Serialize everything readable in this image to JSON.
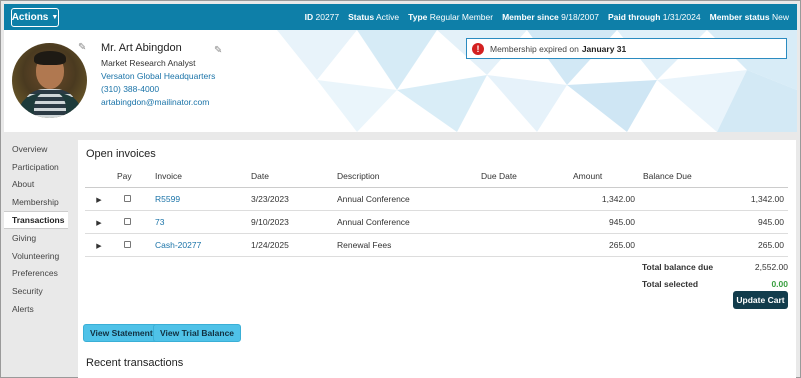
{
  "topbar": {
    "actions_label": "Actions",
    "meta": [
      {
        "label": "ID",
        "value": "20277"
      },
      {
        "label": "Status",
        "value": "Active"
      },
      {
        "label": "Type",
        "value": "Regular Member"
      },
      {
        "label": "Member since",
        "value": "9/18/2007"
      },
      {
        "label": "Paid through",
        "value": "1/31/2024"
      },
      {
        "label": "Member status",
        "value": "New"
      }
    ]
  },
  "profile": {
    "name": "Mr. Art Abingdon",
    "title": "Market Research Analyst",
    "company": "Versaton Global Headquarters",
    "phone": "(310) 388-4000",
    "email": "artabingdon@mailinator.com"
  },
  "alert": {
    "text": "Membership expired on",
    "date": "January 31"
  },
  "sidebar": {
    "items": [
      {
        "label": "Overview"
      },
      {
        "label": "Participation"
      },
      {
        "label": "About"
      },
      {
        "label": "Membership"
      },
      {
        "label": "Transactions",
        "active": true
      },
      {
        "label": "Giving"
      },
      {
        "label": "Volunteering"
      },
      {
        "label": "Preferences"
      },
      {
        "label": "Security"
      },
      {
        "label": "Alerts"
      }
    ]
  },
  "invoices": {
    "title": "Open invoices",
    "columns": [
      "",
      "Pay",
      "Invoice",
      "Date",
      "Description",
      "Due Date",
      "Amount",
      "Balance Due"
    ],
    "rows": [
      {
        "invoice": "R5599",
        "date": "3/23/2023",
        "description": "Annual Conference",
        "due_date": "",
        "amount": "1,342.00",
        "balance": "1,342.00"
      },
      {
        "invoice": "73",
        "date": "9/10/2023",
        "description": "Annual Conference",
        "due_date": "",
        "amount": "945.00",
        "balance": "945.00"
      },
      {
        "invoice": "Cash-20277",
        "date": "1/24/2025",
        "description": "Renewal Fees",
        "due_date": "",
        "amount": "265.00",
        "balance": "265.00"
      }
    ],
    "total_balance_label": "Total balance due",
    "total_balance_value": "2,552.00",
    "total_selected_label": "Total selected",
    "total_selected_value": "0.00",
    "update_cart_label": "Update Cart"
  },
  "buttons": {
    "view_statement": "View Statement",
    "view_trial_balance": "View Trial Balance"
  },
  "recent": {
    "title": "Recent transactions"
  },
  "colors": {
    "brand": "#0e7fa8",
    "alert_red": "#d32020",
    "link": "#1a73a8",
    "selected_green": "#3aa040",
    "dark_button": "#123c4c",
    "light_button": "#4fc2e8"
  }
}
